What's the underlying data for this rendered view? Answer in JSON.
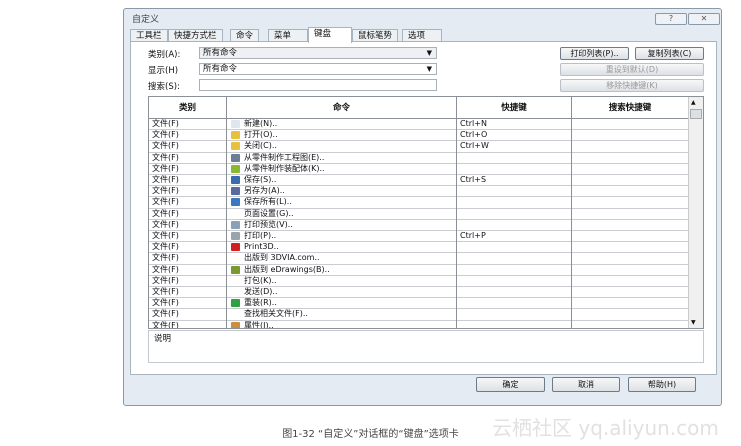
{
  "dialog": {
    "title": "自定义",
    "help_btn": "?",
    "close_btn": "✕"
  },
  "tabs": [
    "工具栏",
    "快捷方式栏",
    "命令",
    "菜单",
    "键盘",
    "鼠标笔势",
    "选项"
  ],
  "active_tab": 4,
  "form": {
    "category_label": "类别(A):",
    "category_value": "所有命令",
    "show_label": "显示(H)",
    "show_value": "所有命令",
    "search_label": "搜索(S):",
    "search_value": ""
  },
  "buttons": {
    "print_list": "打印列表(P)..",
    "copy_list": "复制列表(C)",
    "reset_default": "重设到默认(D)",
    "remove_shortcut": "移除快捷键(K)",
    "ok": "确定",
    "cancel": "取消",
    "help": "帮助(H)"
  },
  "table": {
    "headers": [
      "类别",
      "命令",
      "快捷键",
      "搜索快捷键"
    ],
    "rows": [
      {
        "cat": "文件(F)",
        "cmd": "新建(N)..",
        "key": "Ctrl+N",
        "icon": "new-document-icon",
        "color": "#dfe6ee"
      },
      {
        "cat": "文件(F)",
        "cmd": "打开(O)..",
        "key": "Ctrl+O",
        "icon": "open-folder-icon",
        "color": "#e8c040"
      },
      {
        "cat": "文件(F)",
        "cmd": "关闭(C)..",
        "key": "Ctrl+W",
        "icon": "close-folder-icon",
        "color": "#e8c040"
      },
      {
        "cat": "文件(F)",
        "cmd": "从零件制作工程图(E)..",
        "key": "",
        "icon": "drawing-icon",
        "color": "#6a7f95"
      },
      {
        "cat": "文件(F)",
        "cmd": "从零件制作装配体(K)..",
        "key": "",
        "icon": "assembly-icon",
        "color": "#8ab830"
      },
      {
        "cat": "文件(F)",
        "cmd": "保存(S)..",
        "key": "Ctrl+S",
        "icon": "save-icon",
        "color": "#3a6ab0"
      },
      {
        "cat": "文件(F)",
        "cmd": "另存为(A)..",
        "key": "",
        "icon": "save-as-icon",
        "color": "#5a6aa0"
      },
      {
        "cat": "文件(F)",
        "cmd": "保存所有(L)..",
        "key": "",
        "icon": "save-all-icon",
        "color": "#3a78c0"
      },
      {
        "cat": "文件(F)",
        "cmd": "页面设置(G)..",
        "key": "",
        "icon": "",
        "color": ""
      },
      {
        "cat": "文件(F)",
        "cmd": "打印预览(V)..",
        "key": "",
        "icon": "print-preview-icon",
        "color": "#8aa0b8"
      },
      {
        "cat": "文件(F)",
        "cmd": "打印(P)..",
        "key": "Ctrl+P",
        "icon": "print-icon",
        "color": "#9aa4ae"
      },
      {
        "cat": "文件(F)",
        "cmd": "Print3D..",
        "key": "",
        "icon": "print3d-icon",
        "color": "#d02020"
      },
      {
        "cat": "文件(F)",
        "cmd": "出版到 3DVIA.com..",
        "key": "",
        "icon": "",
        "color": ""
      },
      {
        "cat": "文件(F)",
        "cmd": "出版到 eDrawings(B)..",
        "key": "",
        "icon": "edrawings-icon",
        "color": "#7a9a30"
      },
      {
        "cat": "文件(F)",
        "cmd": "打包(K)..",
        "key": "",
        "icon": "",
        "color": ""
      },
      {
        "cat": "文件(F)",
        "cmd": "发送(D)..",
        "key": "",
        "icon": "",
        "color": ""
      },
      {
        "cat": "文件(F)",
        "cmd": "重装(R)..",
        "key": "",
        "icon": "reload-icon",
        "color": "#30a040"
      },
      {
        "cat": "文件(F)",
        "cmd": "查找相关文件(F)..",
        "key": "",
        "icon": "",
        "color": ""
      },
      {
        "cat": "文件(F)",
        "cmd": "属性(I)..",
        "key": "",
        "icon": "properties-icon",
        "color": "#c89040"
      }
    ]
  },
  "description_label": "说明",
  "caption": "图1-32 “自定义”对话框的“键盘”选项卡",
  "watermark": "云栖社区 yq.aliyun.com"
}
